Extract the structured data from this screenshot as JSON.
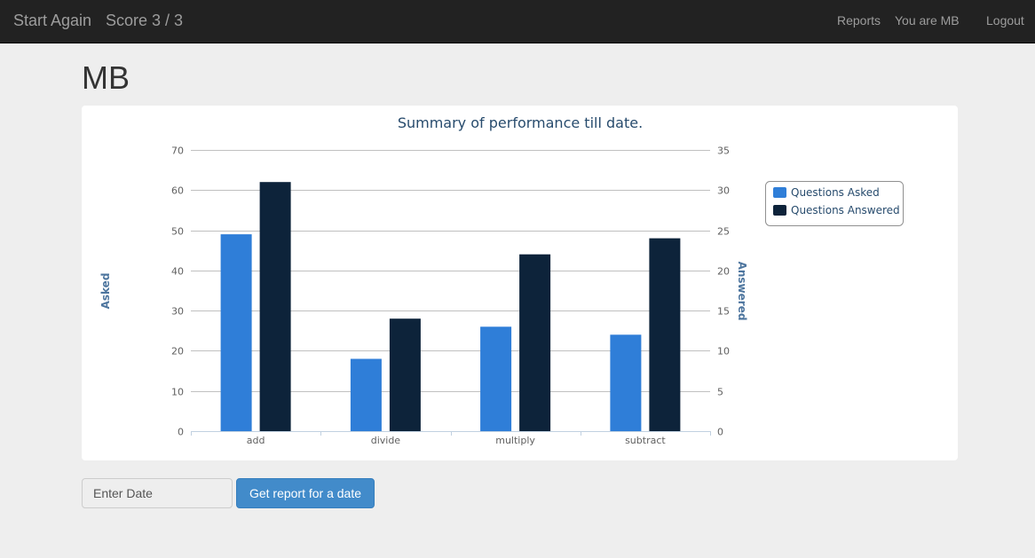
{
  "navbar": {
    "brand_start": "Start Again",
    "score_text": "Score 3 / 3",
    "reports_label": "Reports",
    "user_label": "You are MB",
    "logout_label": "Logout"
  },
  "page": {
    "title": "MB"
  },
  "chart_data": {
    "type": "bar",
    "title": "Summary of performance till date.",
    "categories": [
      "add",
      "divide",
      "multiply",
      "subtract"
    ],
    "series": [
      {
        "name": "Questions Asked",
        "axis": "left",
        "color": "#2f7ed8",
        "values": [
          49,
          18,
          26,
          24
        ]
      },
      {
        "name": "Questions Answered",
        "axis": "right",
        "color": "#0d233a",
        "values": [
          31,
          14,
          22,
          24
        ]
      }
    ],
    "ylabel_left": "Asked",
    "ylabel_right": "Answered",
    "ylim_left": [
      0,
      70
    ],
    "ylim_right": [
      0,
      35
    ],
    "yticks_left": [
      0,
      10,
      20,
      30,
      40,
      50,
      60,
      70
    ],
    "yticks_right": [
      0,
      5,
      10,
      15,
      20,
      25,
      30,
      35
    ],
    "grid": true,
    "legend_placement": "right"
  },
  "report_form": {
    "date_placeholder": "Enter Date",
    "submit_label": "Get report for a date"
  }
}
